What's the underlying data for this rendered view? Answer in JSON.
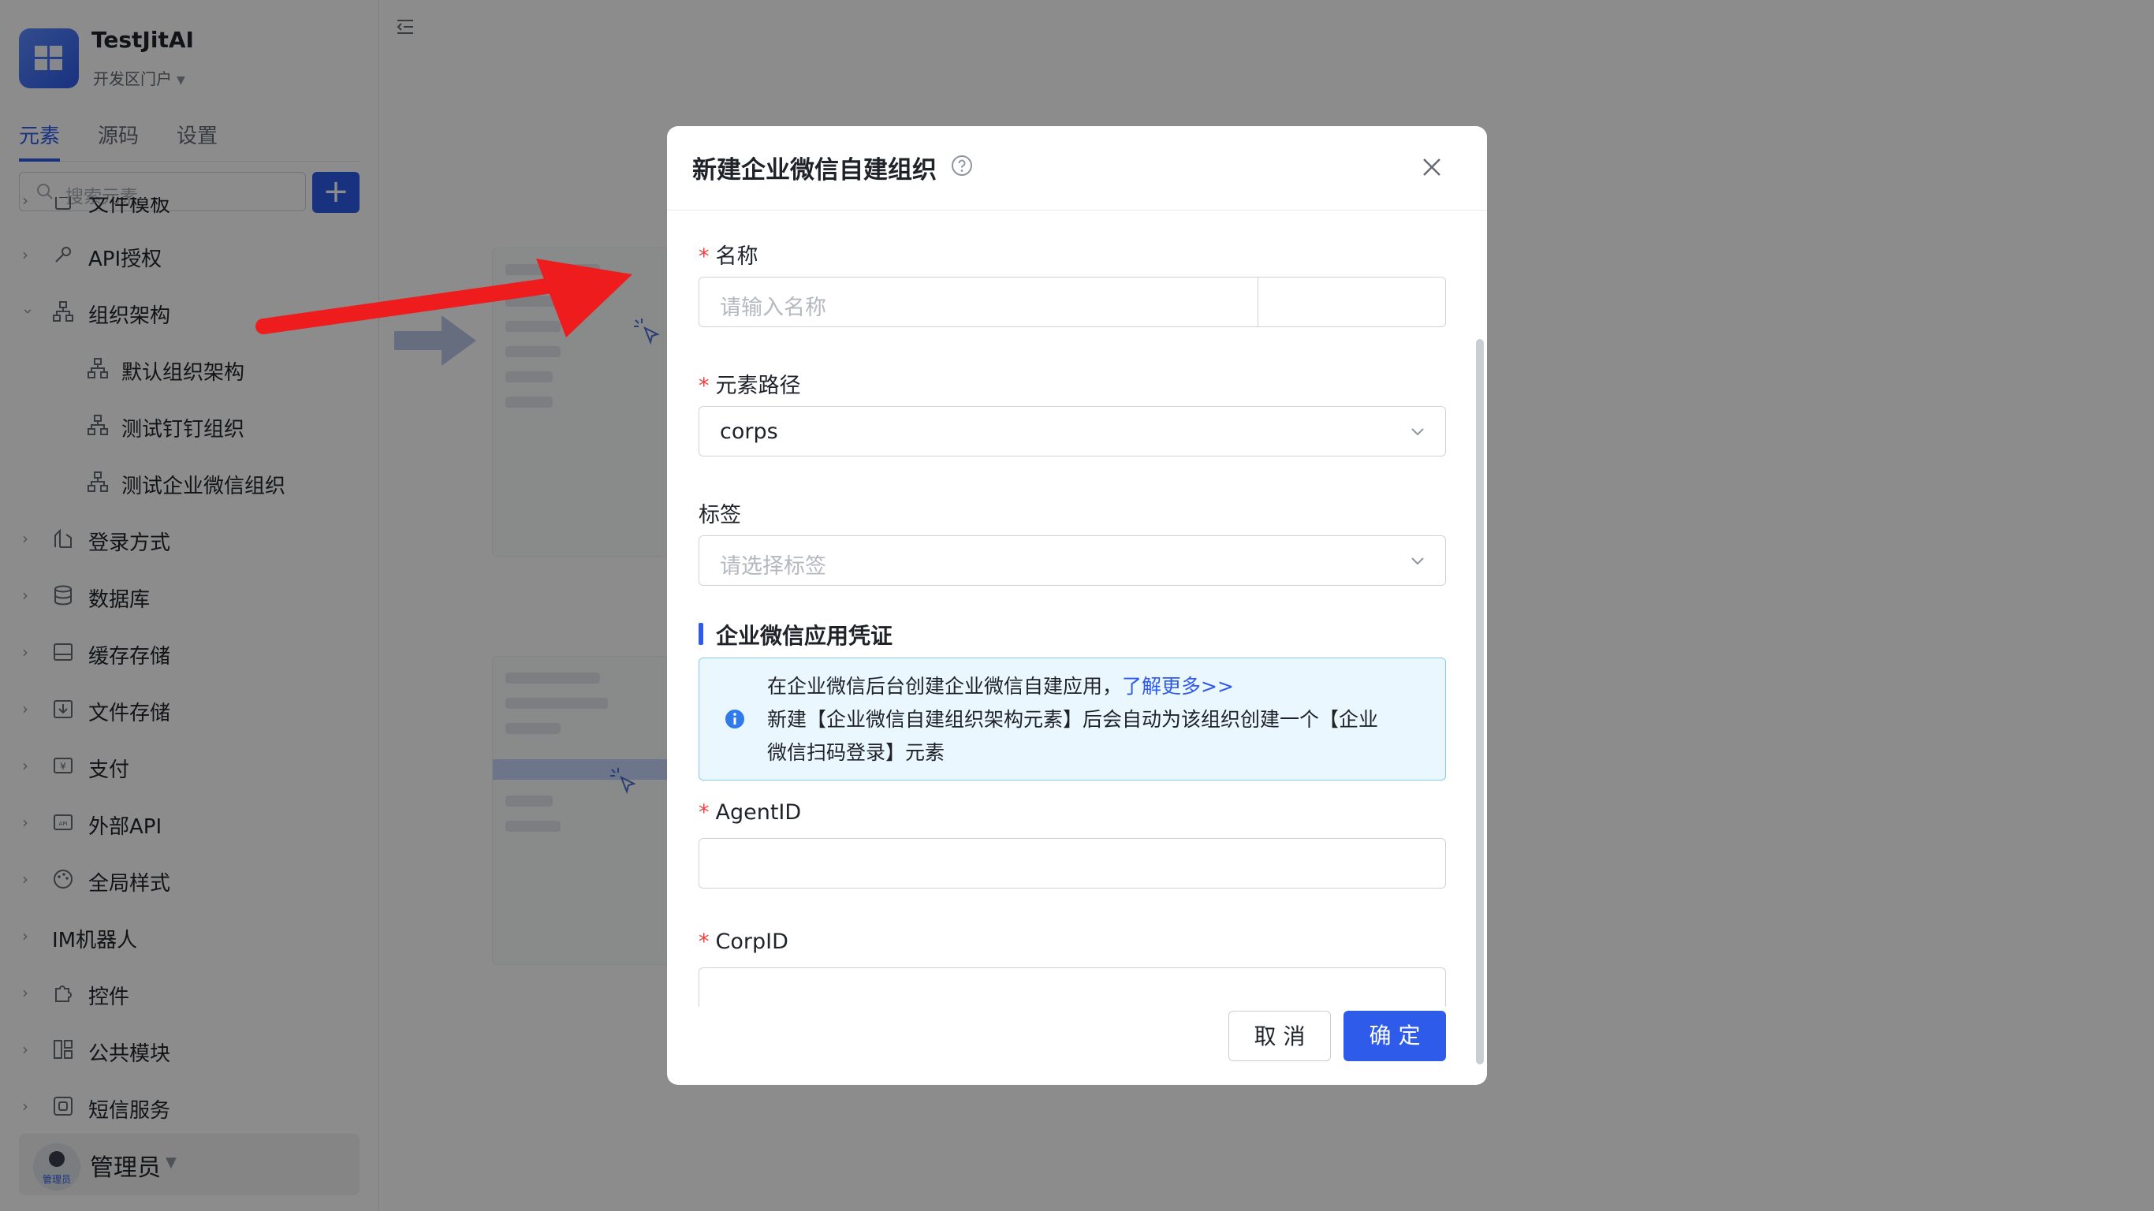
{
  "app": {
    "name": "TestJitAI",
    "portal": "开发区门户"
  },
  "side_tabs": [
    {
      "label": "元素",
      "active": true
    },
    {
      "label": "源码",
      "active": false
    },
    {
      "label": "设置",
      "active": false
    }
  ],
  "search": {
    "placeholder": "搜索元素"
  },
  "tree": [
    {
      "label": "文件模板",
      "level": 0,
      "expanded": false
    },
    {
      "label": "API授权",
      "level": 0,
      "expanded": false
    },
    {
      "label": "组织架构",
      "level": 0,
      "expanded": true
    },
    {
      "label": "默认组织架构",
      "level": 1
    },
    {
      "label": "测试钉钉组织",
      "level": 1
    },
    {
      "label": "测试企业微信组织",
      "level": 1
    },
    {
      "label": "登录方式",
      "level": 0,
      "expanded": false
    },
    {
      "label": "数据库",
      "level": 0,
      "expanded": false
    },
    {
      "label": "缓存存储",
      "level": 0,
      "expanded": false
    },
    {
      "label": "文件存储",
      "level": 0,
      "expanded": false
    },
    {
      "label": "支付",
      "level": 0,
      "expanded": false
    },
    {
      "label": "外部API",
      "level": 0,
      "expanded": false
    },
    {
      "label": "全局样式",
      "level": 0,
      "expanded": false
    },
    {
      "label": "IM机器人",
      "level": 0,
      "expanded": false
    },
    {
      "label": "控件",
      "level": 0,
      "expanded": false
    },
    {
      "label": "公共模块",
      "level": 0,
      "expanded": false
    },
    {
      "label": "短信服务",
      "level": 0,
      "expanded": false
    }
  ],
  "user": {
    "name": "管理员",
    "avatar_tag": "管理员"
  },
  "modal": {
    "title": "新建企业微信自建组织",
    "fields": {
      "name": {
        "label": "名称",
        "placeholder": "请输入名称",
        "value": "",
        "required": true
      },
      "path": {
        "label": "元素路径",
        "value": "corps",
        "required": true
      },
      "tags": {
        "label": "标签",
        "placeholder": "请选择标签",
        "required": false
      },
      "agent_id": {
        "label": "AgentID",
        "value": "",
        "required": true
      },
      "corp_id": {
        "label": "CorpID",
        "value": "",
        "required": true
      }
    },
    "section_title": "企业微信应用凭证",
    "info": {
      "line1": "在企业微信后台创建企业微信自建应用，",
      "link": "了解更多>>",
      "line2": "新建【企业微信自建组织架构元素】后会自动为该组织创建一个【企业",
      "line3": "微信扫码登录】元素"
    },
    "buttons": {
      "cancel": "取 消",
      "ok": "确 定"
    }
  },
  "colors": {
    "primary": "#2f5bea",
    "danger": "#f53f3f",
    "info_bg": "#eaf7fe",
    "arrow": "#ee1c1c"
  }
}
